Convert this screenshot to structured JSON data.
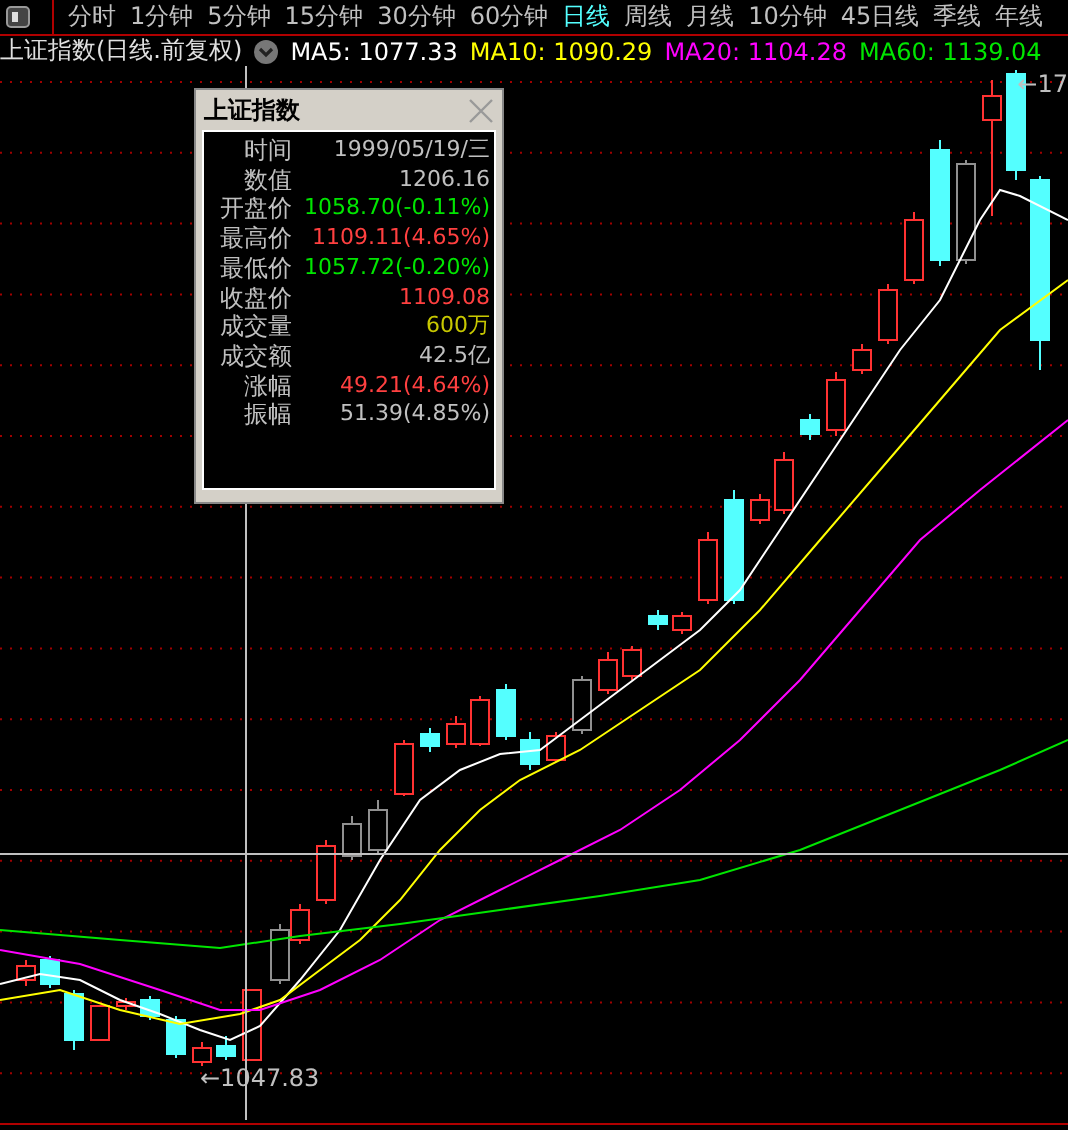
{
  "tabs": [
    {
      "label": "分时",
      "selected": false
    },
    {
      "label": "1分钟",
      "selected": false
    },
    {
      "label": "5分钟",
      "selected": false
    },
    {
      "label": "15分钟",
      "selected": false
    },
    {
      "label": "30分钟",
      "selected": false
    },
    {
      "label": "60分钟",
      "selected": false
    },
    {
      "label": "日线",
      "selected": true
    },
    {
      "label": "周线",
      "selected": false
    },
    {
      "label": "月线",
      "selected": false
    },
    {
      "label": "10分钟",
      "selected": false
    },
    {
      "label": "45日线",
      "selected": false
    },
    {
      "label": "季线",
      "selected": false
    },
    {
      "label": "年线",
      "selected": false
    }
  ],
  "legend": {
    "title": "上证指数(日线.前复权)",
    "averages": [
      {
        "text": "MA5: 1077.33",
        "color": "#ffffff"
      },
      {
        "text": "MA10: 1090.29",
        "color": "#ffff00"
      },
      {
        "text": "MA20: 1104.28",
        "color": "#ff00ff"
      },
      {
        "text": "MA60: 1139.04",
        "color": "#00e600"
      }
    ]
  },
  "chart": {
    "low_label": "←1047.83",
    "high_label": "←17"
  },
  "tooltip": {
    "title": "上证指数",
    "rows": [
      {
        "label": "时间",
        "value": "1999/05/19/三",
        "color": "#c0c0c0"
      },
      {
        "label": "数值",
        "value": "1206.16",
        "color": "#c0c0c0"
      },
      {
        "label": "开盘价",
        "value": "1058.70(-0.11%)",
        "color": "#00e600"
      },
      {
        "label": "最高价",
        "value": "1109.11(4.65%)",
        "color": "#ff4040"
      },
      {
        "label": "最低价",
        "value": "1057.72(-0.20%)",
        "color": "#00e600"
      },
      {
        "label": "收盘价",
        "value": "1109.08",
        "color": "#ff4040"
      },
      {
        "label": "成交量",
        "value": "600万",
        "color": "#c8c800"
      },
      {
        "label": "成交额",
        "value": "42.5亿",
        "color": "#c0c0c0"
      },
      {
        "label": "涨幅",
        "value": "49.21(4.64%)",
        "color": "#ff4040"
      },
      {
        "label": "振幅",
        "value": "51.39(4.85%)",
        "color": "#c0c0c0"
      }
    ]
  }
}
